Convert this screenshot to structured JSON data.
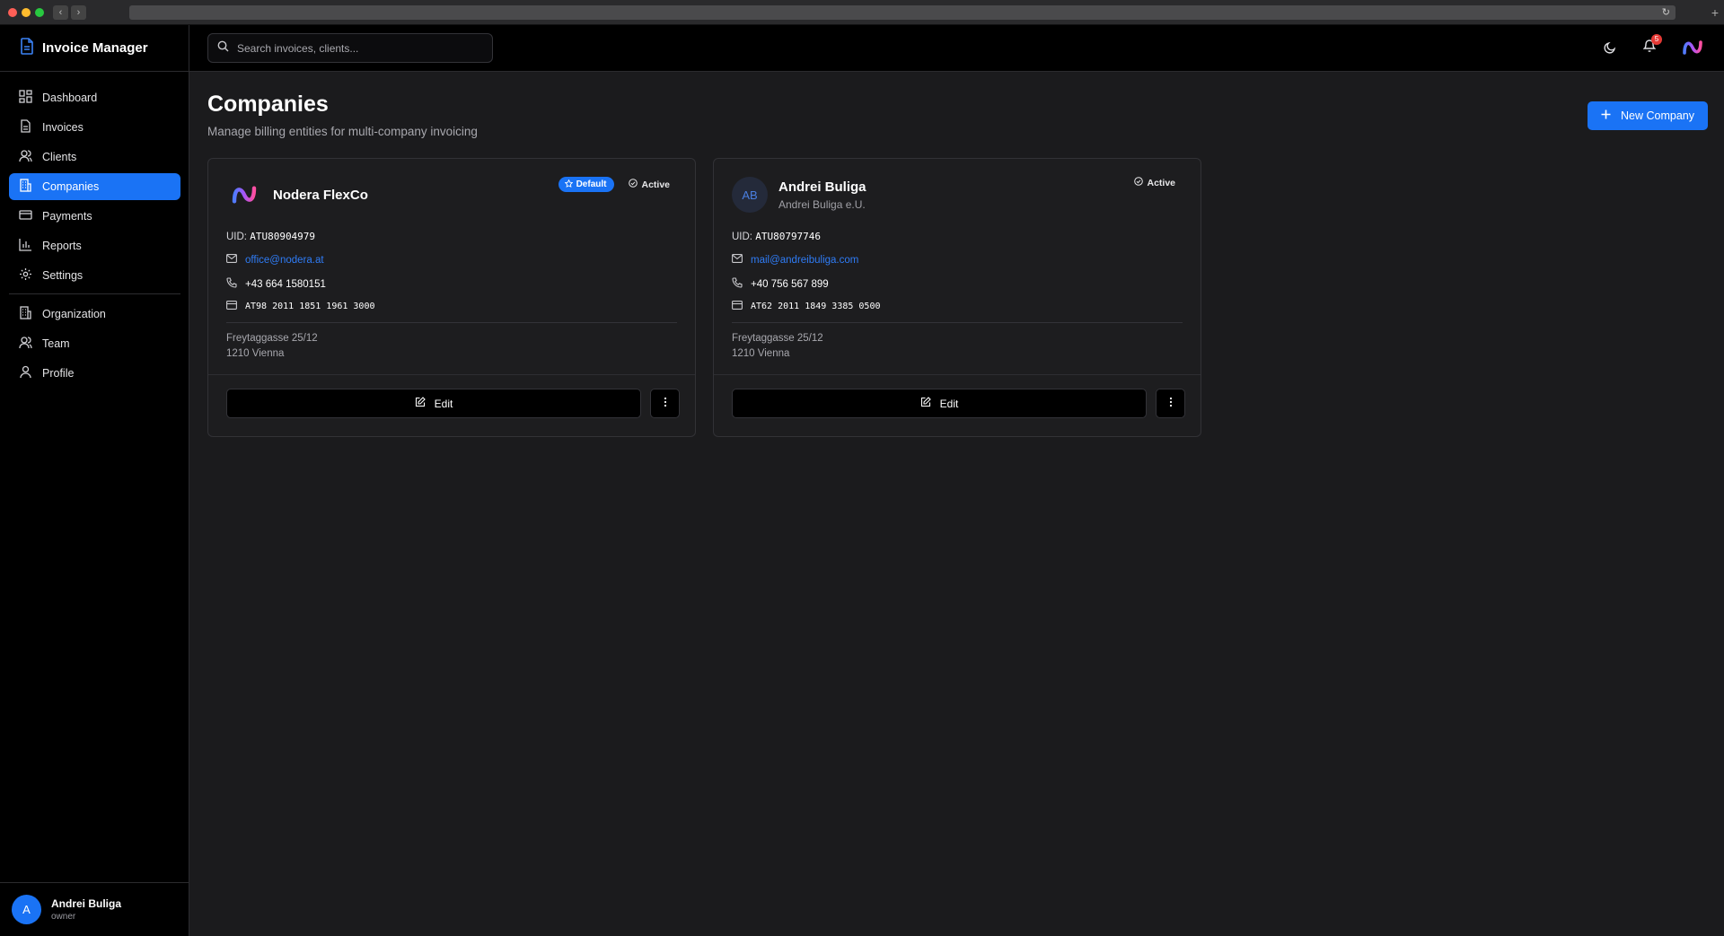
{
  "app": {
    "title": "Invoice Manager"
  },
  "search": {
    "placeholder": "Search invoices, clients..."
  },
  "sidebar": {
    "items": [
      {
        "label": "Dashboard",
        "icon": "dashboard-icon"
      },
      {
        "label": "Invoices",
        "icon": "file-icon"
      },
      {
        "label": "Clients",
        "icon": "users-icon"
      },
      {
        "label": "Companies",
        "icon": "building-icon",
        "active": true
      },
      {
        "label": "Payments",
        "icon": "credit-card-icon"
      },
      {
        "label": "Reports",
        "icon": "bar-chart-icon"
      },
      {
        "label": "Settings",
        "icon": "gear-icon"
      }
    ],
    "secondary": [
      {
        "label": "Organization",
        "icon": "building-icon"
      },
      {
        "label": "Team",
        "icon": "users-icon"
      },
      {
        "label": "Profile",
        "icon": "user-icon"
      }
    ]
  },
  "user": {
    "initial": "A",
    "name": "Andrei Buliga",
    "role": "owner"
  },
  "topbar": {
    "notification_count": "5"
  },
  "page": {
    "title": "Companies",
    "subtitle": "Manage billing entities for multi-company invoicing",
    "new_button": "New Company"
  },
  "companies": [
    {
      "name": "Nodera FlexCo",
      "legal_name": "",
      "default_badge": "Default",
      "status": "Active",
      "uid_label": "UID:",
      "uid": "ATU80904979",
      "email": "office@nodera.at",
      "phone": "+43 664 1580151",
      "iban": "AT98 2011 1851 1961 3000",
      "address_line1": "Freytaggasse 25/12",
      "address_line2": "1210 Vienna",
      "edit_label": "Edit"
    },
    {
      "name": "Andrei Buliga",
      "legal_name": "Andrei Buliga e.U.",
      "initials": "AB",
      "status": "Active",
      "uid_label": "UID:",
      "uid": "ATU80797746",
      "email": "mail@andreibuliga.com",
      "phone": "+40 756 567 899",
      "iban": "AT62 2011 1849 3385 0500",
      "address_line1": "Freytaggasse 25/12",
      "address_line2": "1210 Vienna",
      "edit_label": "Edit"
    }
  ],
  "colors": {
    "accent": "#1a73f5",
    "link": "#2f7cf6",
    "background": "#1b1b1d",
    "sidebar": "#000000"
  }
}
